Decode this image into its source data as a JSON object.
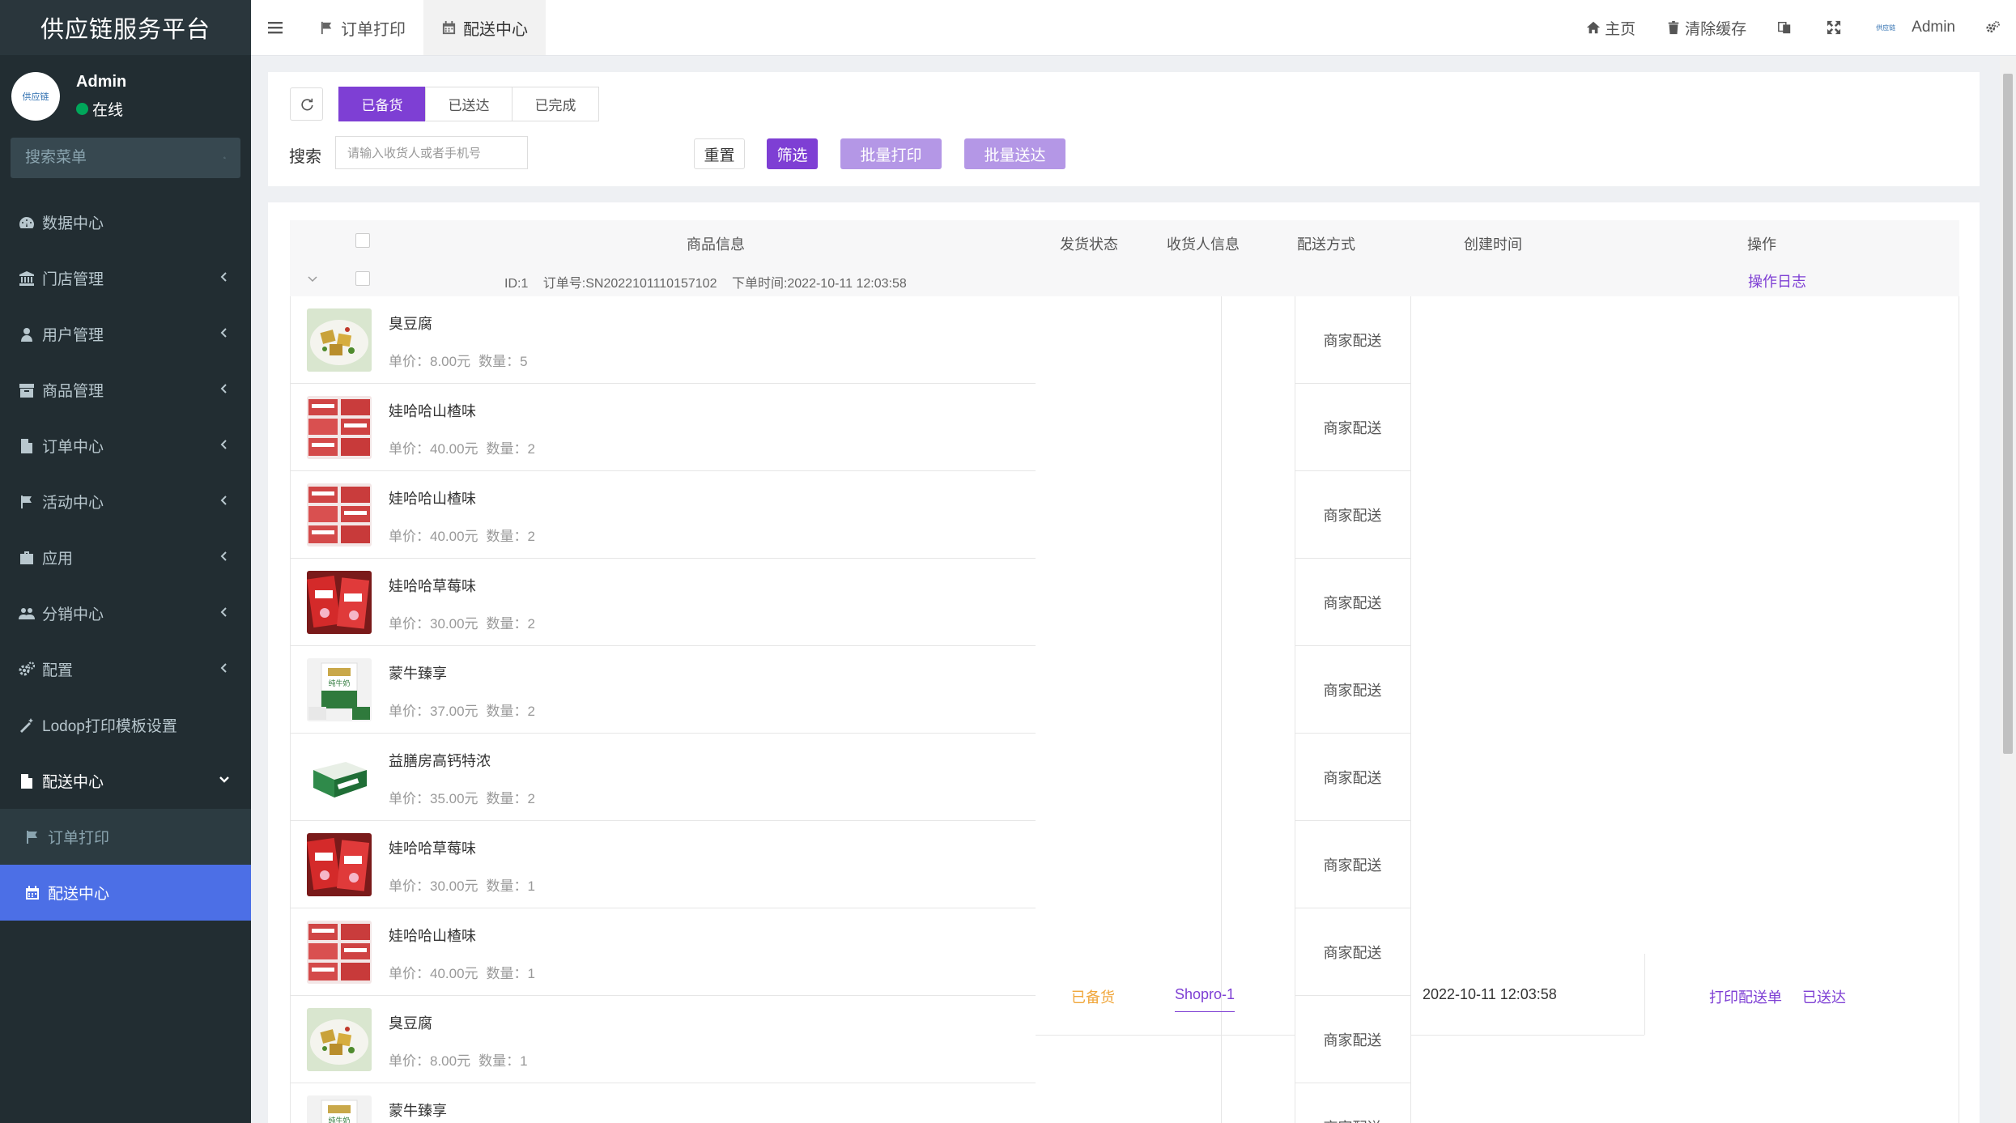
{
  "brand": "供应链服务平台",
  "user": {
    "name": "Admin",
    "status": "在线",
    "avatar_text": "供应链"
  },
  "sidebar": {
    "search_placeholder": "搜索菜单",
    "items": [
      {
        "label": "数据中心",
        "icon": "dashboard-icon",
        "has_arrow": false
      },
      {
        "label": "门店管理",
        "icon": "bank-icon",
        "has_arrow": true
      },
      {
        "label": "用户管理",
        "icon": "user-icon",
        "has_arrow": true
      },
      {
        "label": "商品管理",
        "icon": "archive-icon",
        "has_arrow": true
      },
      {
        "label": "订单中心",
        "icon": "file-icon",
        "has_arrow": true
      },
      {
        "label": "活动中心",
        "icon": "flag-icon",
        "has_arrow": true
      },
      {
        "label": "应用",
        "icon": "briefcase-icon",
        "has_arrow": true
      },
      {
        "label": "分销中心",
        "icon": "users-icon",
        "has_arrow": true
      },
      {
        "label": "配置",
        "icon": "cogs-icon",
        "has_arrow": true
      },
      {
        "label": "Lodop打印模板设置",
        "icon": "magic-icon",
        "has_arrow": false
      },
      {
        "label": "配送中心",
        "icon": "file-icon",
        "has_arrow": true,
        "open": true
      }
    ],
    "subitems": [
      {
        "label": "订单打印",
        "icon": "flag-icon"
      },
      {
        "label": "配送中心",
        "icon": "calendar-icon",
        "active": true
      }
    ]
  },
  "topbar": {
    "tabs": [
      {
        "label": "订单打印",
        "icon": "flag-icon"
      },
      {
        "label": "配送中心",
        "icon": "calendar-icon",
        "active": true
      }
    ],
    "home": "主页",
    "clear_cache": "清除缓存",
    "admin": "Admin",
    "mini_logo": "供应链"
  },
  "toolbar": {
    "status_tabs": [
      "已备货",
      "已送达",
      "已完成"
    ],
    "search_label": "搜索",
    "search_placeholder": "请输入收货人或者手机号",
    "reset": "重置",
    "filter": "筛选",
    "batch_print": "批量打印",
    "batch_deliver": "批量送达"
  },
  "table": {
    "headers": [
      "商品信息",
      "发货状态",
      "收货人信息",
      "配送方式",
      "创建时间",
      "操作"
    ],
    "order": {
      "id": "ID:1",
      "order_no": "订单号:SN2022101110157102",
      "order_time": "下单时间:2022-10-11 12:03:58",
      "log": "操作日志",
      "status": "已备货",
      "receiver": "Shopro-1",
      "created": "2022-10-11 12:03:58",
      "action_print": "打印配送单",
      "action_deliver": "已送达"
    },
    "items": [
      {
        "name": "臭豆腐",
        "price": "单价：8.00元",
        "qty": "数量：5",
        "delivery": "商家配送",
        "thumb": "tofu"
      },
      {
        "name": "娃哈哈山楂味",
        "price": "单价：40.00元",
        "qty": "数量：2",
        "delivery": "商家配送",
        "thumb": "boxes"
      },
      {
        "name": "娃哈哈山楂味",
        "price": "单价：40.00元",
        "qty": "数量：2",
        "delivery": "商家配送",
        "thumb": "boxes"
      },
      {
        "name": "娃哈哈草莓味",
        "price": "单价：30.00元",
        "qty": "数量：2",
        "delivery": "商家配送",
        "thumb": "redpack"
      },
      {
        "name": "蒙牛臻享",
        "price": "单价：37.00元",
        "qty": "数量：2",
        "delivery": "商家配送",
        "thumb": "milk"
      },
      {
        "name": "益膳房高钙特浓",
        "price": "单价：35.00元",
        "qty": "数量：2",
        "delivery": "商家配送",
        "thumb": "greenbox"
      },
      {
        "name": "娃哈哈草莓味",
        "price": "单价：30.00元",
        "qty": "数量：1",
        "delivery": "商家配送",
        "thumb": "redpack"
      },
      {
        "name": "娃哈哈山楂味",
        "price": "单价：40.00元",
        "qty": "数量：1",
        "delivery": "商家配送",
        "thumb": "boxes"
      },
      {
        "name": "臭豆腐",
        "price": "单价：8.00元",
        "qty": "数量：1",
        "delivery": "商家配送",
        "thumb": "tofu"
      },
      {
        "name": "蒙牛臻享",
        "price": "",
        "qty": "",
        "delivery": "商家配送",
        "thumb": "milk"
      }
    ]
  },
  "colors": {
    "sidebar_bg": "#222d32",
    "accent": "#7e3fd4",
    "active_menu": "#4c6fe6",
    "status_orange": "#f0a63a"
  }
}
